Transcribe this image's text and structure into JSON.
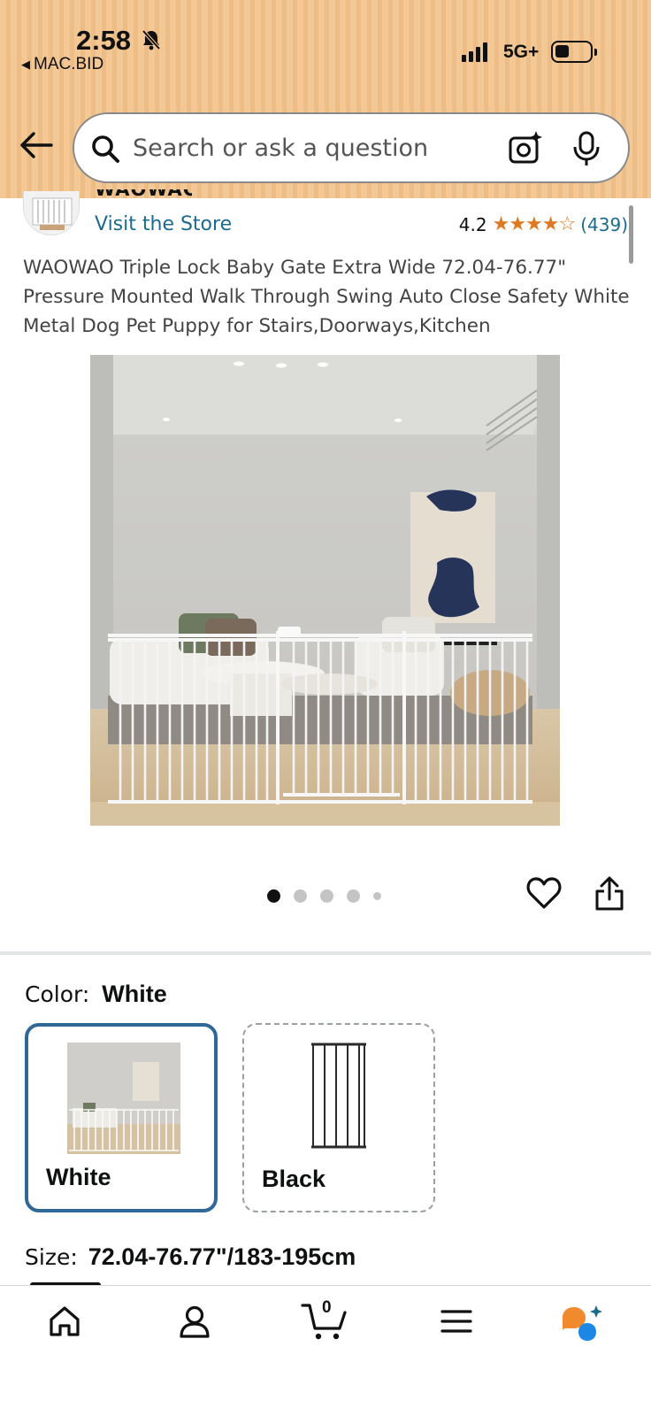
{
  "status_bar": {
    "time": "2:58",
    "back_app": "MAC.BID",
    "network": "5G+"
  },
  "search": {
    "placeholder": "Search or ask a question"
  },
  "store": {
    "brand": "WAOWAO",
    "visit_label": "Visit the Store",
    "rating": "4.2",
    "stars": "★★★★☆",
    "review_count": "(439)"
  },
  "product": {
    "title": "WAOWAO Triple Lock Baby Gate Extra Wide 72.04-76.77\" Pressure Mounted Walk Through Swing Auto Close Safety White Metal Dog Pet Puppy for Stairs,Doorways,Kitchen",
    "image_count": 5,
    "active_image": 1
  },
  "options": {
    "color_label": "Color:",
    "color_value": "White",
    "swatches": [
      {
        "label": "White",
        "selected": true
      },
      {
        "label": "Black",
        "selected": false
      }
    ],
    "size_label": "Size:",
    "size_value": "72.04-76.77\"/183-195cm"
  },
  "bottom_nav": {
    "items": [
      "home-icon",
      "account-icon",
      "cart-icon",
      "menu-icon",
      "rufus-icon"
    ],
    "cart_count": "0",
    "active": "home"
  },
  "colors": {
    "header_bg": "#f3c895",
    "link": "#1d6a8f",
    "star": "#de7921",
    "selected_border": "#2f6797"
  }
}
